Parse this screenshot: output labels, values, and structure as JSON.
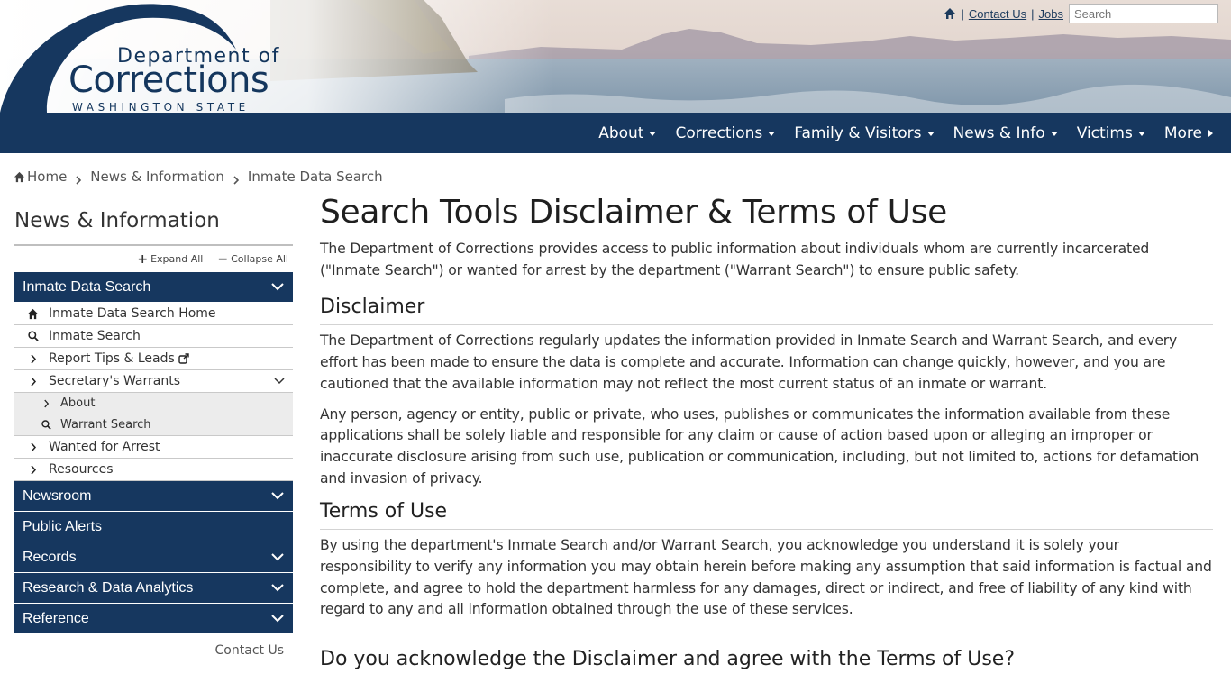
{
  "logo": {
    "line1": "Department of",
    "line2": "Corrections",
    "line3": "WASHINGTON STATE"
  },
  "utility": {
    "contact": "Contact Us",
    "jobs": "Jobs",
    "search_placeholder": "Search"
  },
  "nav": {
    "items": [
      {
        "label": "About"
      },
      {
        "label": "Corrections"
      },
      {
        "label": "Family & Visitors"
      },
      {
        "label": "News & Info"
      },
      {
        "label": "Victims"
      },
      {
        "label": "More"
      }
    ]
  },
  "breadcrumb": {
    "home": "Home",
    "news": "News & Information",
    "current": "Inmate Data Search"
  },
  "sidebar": {
    "title": "News & Information",
    "expand_all": "Expand All",
    "collapse_all": "Collapse All",
    "sections": [
      {
        "label": "Inmate Data Search"
      },
      {
        "label": "Newsroom"
      },
      {
        "label": "Public Alerts"
      },
      {
        "label": "Records"
      },
      {
        "label": "Research & Data Analytics"
      },
      {
        "label": "Reference"
      }
    ],
    "items": [
      {
        "label": "Inmate Data Search Home"
      },
      {
        "label": "Inmate Search"
      },
      {
        "label": "Report Tips & Leads"
      },
      {
        "label": "Secretary's Warrants"
      },
      {
        "label": "About"
      },
      {
        "label": "Warrant Search"
      },
      {
        "label": "Wanted for Arrest"
      },
      {
        "label": "Resources"
      }
    ],
    "contact": "Contact Us"
  },
  "main": {
    "title": "Search Tools Disclaimer & Terms of Use",
    "intro": "The Department of Corrections provides access to public information about individuals whom are currently incarcerated (\"Inmate Search\") or wanted for arrest by the department (\"Warrant Search\") to ensure public safety.",
    "disclaimer_heading": "Disclaimer",
    "disclaimer_p1": "The Department of Corrections regularly updates the information provided in Inmate Search and Warrant Search, and every effort has been made to ensure the data is complete and accurate. Information can change quickly, however, and you are cautioned that the available information may not reflect the most current status of an inmate or warrant.",
    "disclaimer_p2": "Any person, agency or entity, public or private, who uses, publishes or communicates the information available from these applications shall be solely liable and responsible for any claim or cause of action based upon or alleging an improper or inaccurate disclosure arising from such use, publication or communication, including, but not limited to, actions for defamation and invasion of privacy.",
    "terms_heading": "Terms of Use",
    "terms_p1": "By using the department's Inmate Search and/or Warrant Search, you acknowledge you understand it is solely your responsibility to verify any information you may obtain herein before making any assumption that said information is factual and complete, and agree to hold the department harmless for any damages, direct or indirect, and free of liability of any kind with regard to any and all information obtained through the use of these services.",
    "question": "Do you acknowledge the Disclaimer and agree with the Terms of Use?"
  },
  "colors": {
    "navy": "#16375f",
    "text": "#333333"
  }
}
